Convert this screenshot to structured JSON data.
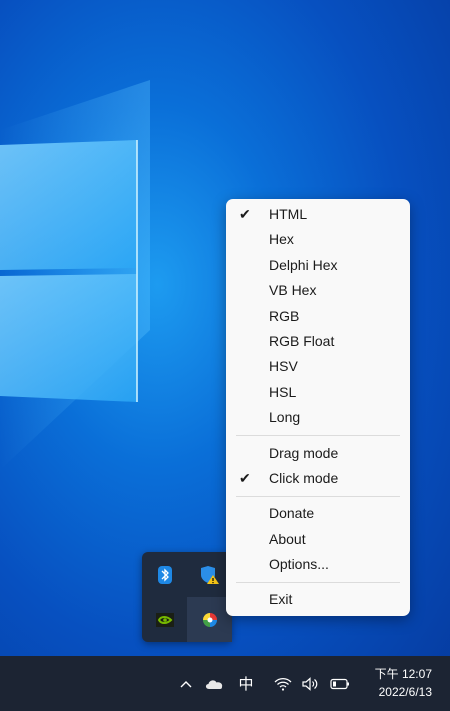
{
  "menu": {
    "group1": [
      {
        "label": "HTML",
        "checked": true
      },
      {
        "label": "Hex",
        "checked": false
      },
      {
        "label": "Delphi Hex",
        "checked": false
      },
      {
        "label": "VB Hex",
        "checked": false
      },
      {
        "label": "RGB",
        "checked": false
      },
      {
        "label": "RGB Float",
        "checked": false
      },
      {
        "label": "HSV",
        "checked": false
      },
      {
        "label": "HSL",
        "checked": false
      },
      {
        "label": "Long",
        "checked": false
      }
    ],
    "group2": [
      {
        "label": "Drag mode",
        "checked": false
      },
      {
        "label": "Click mode",
        "checked": true
      }
    ],
    "group3": [
      {
        "label": "Donate"
      },
      {
        "label": "About"
      },
      {
        "label": "Options..."
      }
    ],
    "group4": [
      {
        "label": "Exit"
      }
    ],
    "check_glyph": "✔"
  },
  "tray_overflow": {
    "icons": [
      "bluetooth-icon",
      "windows-security-icon",
      "nvidia-icon",
      "color-picker-icon"
    ]
  },
  "taskbar": {
    "ime_label": "中",
    "clock_time": "下午 12:07",
    "clock_date": "2022/6/13",
    "chevron_glyph": "^"
  },
  "colors": {
    "menu_bg": "#f9f9f9",
    "taskbar_bg": "#1c2433",
    "tray_popup_bg": "#1f2b3e",
    "desktop_blue": "#0a6fd8"
  }
}
